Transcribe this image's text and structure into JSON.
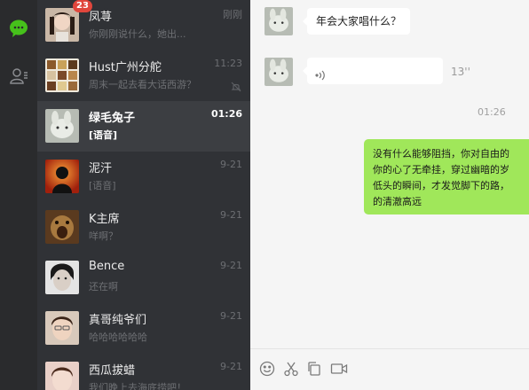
{
  "sidebar": {
    "icons": [
      "chat-bubble-icon",
      "contacts-icon"
    ]
  },
  "conversations": [
    {
      "name": "凤荨",
      "time": "刚刚",
      "preview": "你刚刚说什么，她出...",
      "badge": "23",
      "active": false
    },
    {
      "name": "Hust广州分舵",
      "time": "11:23",
      "preview": "周末一起去看大话西游？",
      "muted": true,
      "active": false
    },
    {
      "name": "绿毛兔子",
      "time": "01:26",
      "preview": "[语音]",
      "active": true
    },
    {
      "name": "泥汗",
      "time": "9-21",
      "preview": "[语音]",
      "active": false
    },
    {
      "name": "K主席",
      "time": "9-21",
      "preview": "咩啊？",
      "active": false
    },
    {
      "name": "Bence",
      "time": "9-21",
      "preview": "还在啊",
      "active": false
    },
    {
      "name": "真哥纯爷们",
      "time": "9-21",
      "preview": "哈哈哈哈哈哈",
      "active": false
    },
    {
      "name": "西瓜拔蜡",
      "time": "9-21",
      "preview": "我们晚上去海底捞吧！",
      "active": false
    }
  ],
  "chat": {
    "messages": [
      {
        "type": "text",
        "direction": "in",
        "text": "年会大家唱什么？"
      },
      {
        "type": "voice",
        "direction": "in",
        "duration": "13''"
      },
      {
        "type": "timestamp",
        "text": "01:26"
      },
      {
        "type": "text",
        "direction": "out",
        "lines": [
          "没有什么能够阻挡，你对自由的",
          "你的心了无牵挂，穿过幽暗的岁",
          "低头的瞬间，才发觉脚下的路，",
          "的清澈高远"
        ]
      }
    ]
  },
  "toolbar": {
    "icons": [
      "emoji-icon",
      "scissors-icon",
      "copy-icon",
      "video-call-icon"
    ]
  },
  "colors": {
    "rail": "#2a2b2d",
    "list": "#303236",
    "active_row": "#3c3e42",
    "chat_bg": "#f5f5f5",
    "bubble_out": "#a0e75a",
    "badge": "#e0463c",
    "accent": "#46c11b"
  }
}
